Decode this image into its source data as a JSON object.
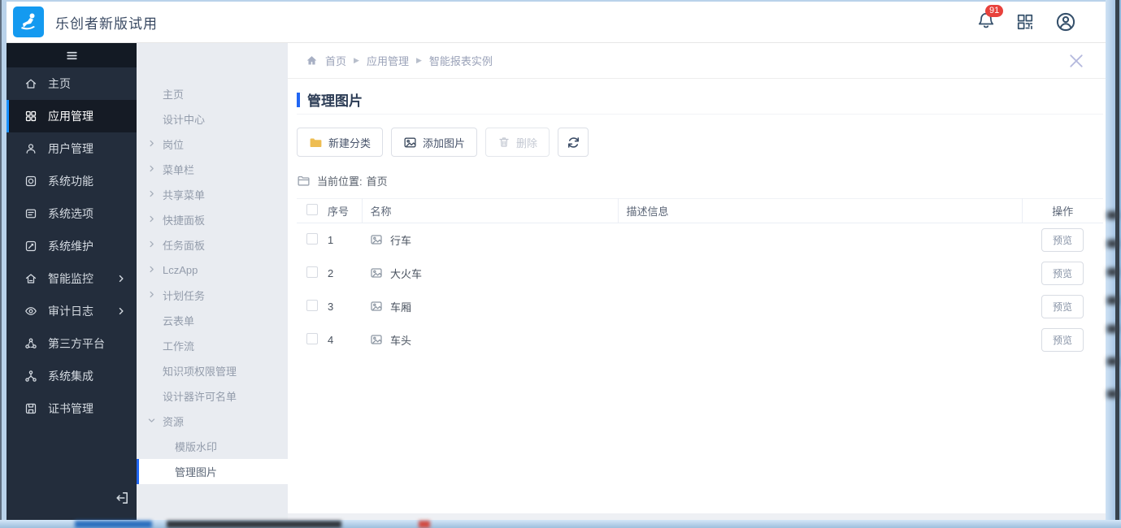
{
  "header": {
    "title": "乐创者新版试用",
    "notification_count": "91"
  },
  "sidebar": {
    "items": [
      {
        "label": "主页",
        "icon": "home-icon"
      },
      {
        "label": "应用管理",
        "icon": "apps-icon",
        "active": true
      },
      {
        "label": "用户管理",
        "icon": "users-icon"
      },
      {
        "label": "系统功能",
        "icon": "system-functions-icon"
      },
      {
        "label": "系统选项",
        "icon": "system-options-icon"
      },
      {
        "label": "系统维护",
        "icon": "system-maintenance-icon"
      },
      {
        "label": "智能监控",
        "icon": "monitor-icon",
        "expandable": true
      },
      {
        "label": "审计日志",
        "icon": "audit-log-icon",
        "expandable": true
      },
      {
        "label": "第三方平台",
        "icon": "third-party-icon"
      },
      {
        "label": "系统集成",
        "icon": "integration-icon"
      },
      {
        "label": "证书管理",
        "icon": "certificate-icon"
      }
    ]
  },
  "submenu": {
    "items": [
      {
        "label": "主页"
      },
      {
        "label": "设计中心"
      },
      {
        "label": "岗位",
        "expandable": true
      },
      {
        "label": "菜单栏",
        "expandable": true
      },
      {
        "label": "共享菜单",
        "expandable": true
      },
      {
        "label": "快捷面板",
        "expandable": true
      },
      {
        "label": "任务面板",
        "expandable": true
      },
      {
        "label": "LczApp",
        "expandable": true
      },
      {
        "label": "计划任务",
        "expandable": true
      },
      {
        "label": "云表单"
      },
      {
        "label": "工作流"
      },
      {
        "label": "知识项权限管理"
      },
      {
        "label": "设计器许可名单"
      },
      {
        "label": "资源",
        "expanded": true
      },
      {
        "label": "模版水印",
        "child": true
      },
      {
        "label": "管理图片",
        "child": true,
        "active": true
      }
    ]
  },
  "breadcrumb": {
    "items": [
      "首页",
      "应用管理",
      "智能报表实例"
    ]
  },
  "main": {
    "title": "管理图片",
    "toolbar": {
      "new_category": "新建分类",
      "add_image": "添加图片",
      "delete": "删除"
    },
    "location": {
      "label": "当前位置:",
      "value": "首页"
    },
    "table": {
      "headers": {
        "index": "序号",
        "name": "名称",
        "description": "描述信息",
        "actions": "操作"
      },
      "preview_label": "预览",
      "rows": [
        {
          "index": "1",
          "name": "行车",
          "description": "",
          "action": "预览"
        },
        {
          "index": "2",
          "name": "大火车",
          "description": "",
          "action": "预览"
        },
        {
          "index": "3",
          "name": "车厢",
          "description": "",
          "action": "预览"
        },
        {
          "index": "4",
          "name": "车头",
          "description": "",
          "action": "预览"
        }
      ]
    }
  },
  "colors": {
    "accent_blue": "#2166f3",
    "sidebar_active_blue": "#1890ff",
    "badge_red": "#e8413c",
    "folder_yellow": "#eebd52",
    "sidebar_bg": "#232d3c",
    "submenu_bg": "#e9ecf1"
  }
}
